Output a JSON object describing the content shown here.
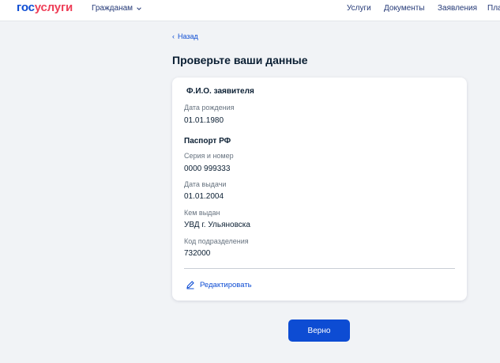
{
  "header": {
    "logo_part1": "гос",
    "logo_part2": "услуги",
    "citizens_label": "Гражданам",
    "nav": [
      "Услуги",
      "Документы",
      "Заявления",
      "Пла"
    ]
  },
  "back_label": "Назад",
  "page_title": "Проверьте ваши данные",
  "card": {
    "applicant_heading": "Ф.И.О. заявителя",
    "birth_label": "Дата рождения",
    "birth_value": "01.01.1980",
    "passport_heading": "Паспорт РФ",
    "series_label": "Серия и номер",
    "series_value": "0000 999333",
    "issue_date_label": "Дата выдачи",
    "issue_date_value": "01.01.2004",
    "issued_by_label": "Кем выдан",
    "issued_by_value": "УВД г. Ульяновска",
    "code_label": "Код подразделения",
    "code_value": "732000",
    "edit_label": "Редактировать"
  },
  "confirm_label": "Верно",
  "colors": {
    "accent": "#0d4cd3",
    "logo_red": "#ee3f58",
    "background": "#f1f3f6"
  }
}
